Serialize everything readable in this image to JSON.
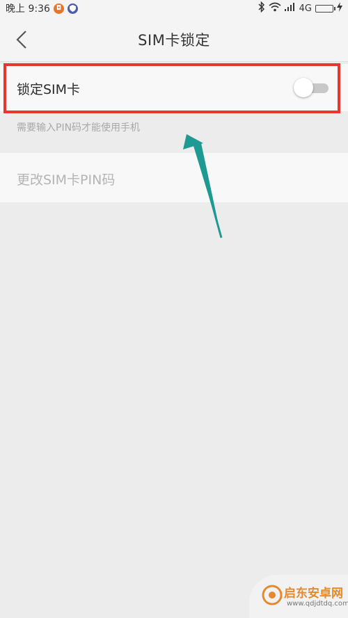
{
  "status_bar": {
    "time": "晚上 9:36",
    "network": "4G"
  },
  "header": {
    "title": "SIM卡锁定"
  },
  "settings": {
    "lock_sim": {
      "label": "锁定SIM卡",
      "enabled": false
    },
    "hint": "需要输入PIN码才能使用手机",
    "change_pin": {
      "label": "更改SIM卡PIN码",
      "disabled": true
    }
  },
  "watermark": {
    "name": "启东安卓网",
    "url": "www.qdjdtdq.com"
  },
  "colors": {
    "highlight": "#e8352e",
    "arrow": "#1e9a92",
    "toggle_track": "#c8c8c8"
  },
  "icons": [
    "back-arrow-icon",
    "bluetooth-icon",
    "wifi-icon",
    "signal-icon",
    "battery-icon"
  ]
}
